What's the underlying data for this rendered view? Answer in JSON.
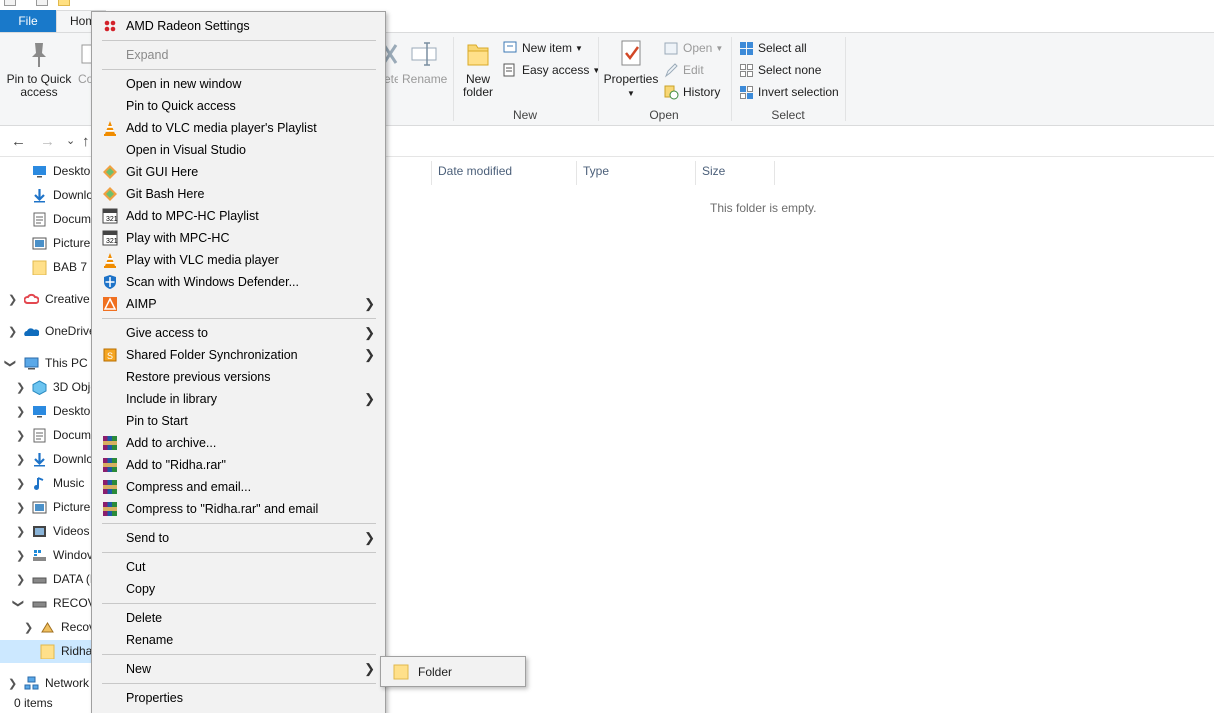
{
  "window": {
    "title": "Ridha"
  },
  "ribbon": {
    "tabs": {
      "file": "File",
      "home": "Home"
    },
    "clipboard": {
      "pin_label_1": "Pin to Quick",
      "pin_label_2": "access",
      "copy_partial": "Co"
    },
    "organize": {
      "delete_partial": "ete",
      "rename": "Rename"
    },
    "new_group": {
      "label": "New",
      "new_folder_1": "New",
      "new_folder_2": "folder",
      "new_item": "New item",
      "easy_access": "Easy access"
    },
    "open_group": {
      "label": "Open",
      "properties": "Properties",
      "open": "Open",
      "edit": "Edit",
      "history": "History"
    },
    "select_group": {
      "label": "Select",
      "select_all": "Select all",
      "select_none": "Select none",
      "invert_selection": "Invert selection"
    }
  },
  "nav": {
    "back": "←",
    "forward": "→",
    "recent": "⌄",
    "up": "↑"
  },
  "tree": {
    "items": [
      {
        "label": "Deskto",
        "icon": "desktop-icon"
      },
      {
        "label": "Downlo",
        "icon": "download-icon"
      },
      {
        "label": "Docum",
        "icon": "document-icon"
      },
      {
        "label": "Picture",
        "icon": "pictures-icon"
      },
      {
        "label": "BAB 7",
        "icon": "folder-icon"
      },
      {
        "label": "Creative",
        "icon": "creative-cloud-icon"
      },
      {
        "label": "OneDrive",
        "icon": "onedrive-icon"
      },
      {
        "label": "This PC",
        "icon": "this-pc-icon"
      },
      {
        "label": "3D Obje",
        "icon": "3d-objects-icon"
      },
      {
        "label": "Deskto",
        "icon": "desktop-icon"
      },
      {
        "label": "Docum",
        "icon": "document-icon"
      },
      {
        "label": "Downlo",
        "icon": "download-icon"
      },
      {
        "label": "Music",
        "icon": "music-icon"
      },
      {
        "label": "Picture",
        "icon": "pictures-icon"
      },
      {
        "label": "Videos",
        "icon": "videos-icon"
      },
      {
        "label": "Windov",
        "icon": "windows-drive-icon"
      },
      {
        "label": "DATA (D",
        "icon": "drive-icon"
      },
      {
        "label": "RECOV",
        "icon": "drive-icon"
      },
      {
        "label": "Recov",
        "icon": "recovery-icon"
      },
      {
        "label": "Ridha",
        "icon": "folder-icon"
      },
      {
        "label": "Network",
        "icon": "network-icon"
      }
    ]
  },
  "content": {
    "columns": {
      "date_modified": "Date modified",
      "type": "Type",
      "size": "Size"
    },
    "empty_message": "This folder is empty."
  },
  "status": {
    "items": "0 items"
  },
  "context_menu": {
    "amd": "AMD Radeon Settings",
    "expand": "Expand",
    "open_new_window": "Open in new window",
    "pin_quick_access": "Pin to Quick access",
    "vlc_playlist": "Add to VLC media player's Playlist",
    "open_visual_studio": "Open in Visual Studio",
    "git_gui": "Git GUI Here",
    "git_bash": "Git Bash Here",
    "mpc_playlist": "Add to MPC-HC Playlist",
    "play_mpc": "Play with MPC-HC",
    "play_vlc": "Play with VLC media player",
    "defender": "Scan with Windows Defender...",
    "aimp": "AIMP",
    "give_access": "Give access to",
    "shared_sync": "Shared Folder Synchronization",
    "restore": "Restore previous versions",
    "include_library": "Include in library",
    "pin_start": "Pin to Start",
    "add_archive": "Add to archive...",
    "add_rar": "Add to \"Ridha.rar\"",
    "compress_email": "Compress and email...",
    "compress_rar_email": "Compress to \"Ridha.rar\" and email",
    "send_to": "Send to",
    "cut": "Cut",
    "copy": "Copy",
    "delete": "Delete",
    "rename": "Rename",
    "new": "New",
    "properties": "Properties"
  },
  "submenu": {
    "folder": "Folder"
  },
  "colors": {
    "accent": "#1979ca",
    "selection": "#cce8ff",
    "menu_bg": "#f2f2f2"
  }
}
